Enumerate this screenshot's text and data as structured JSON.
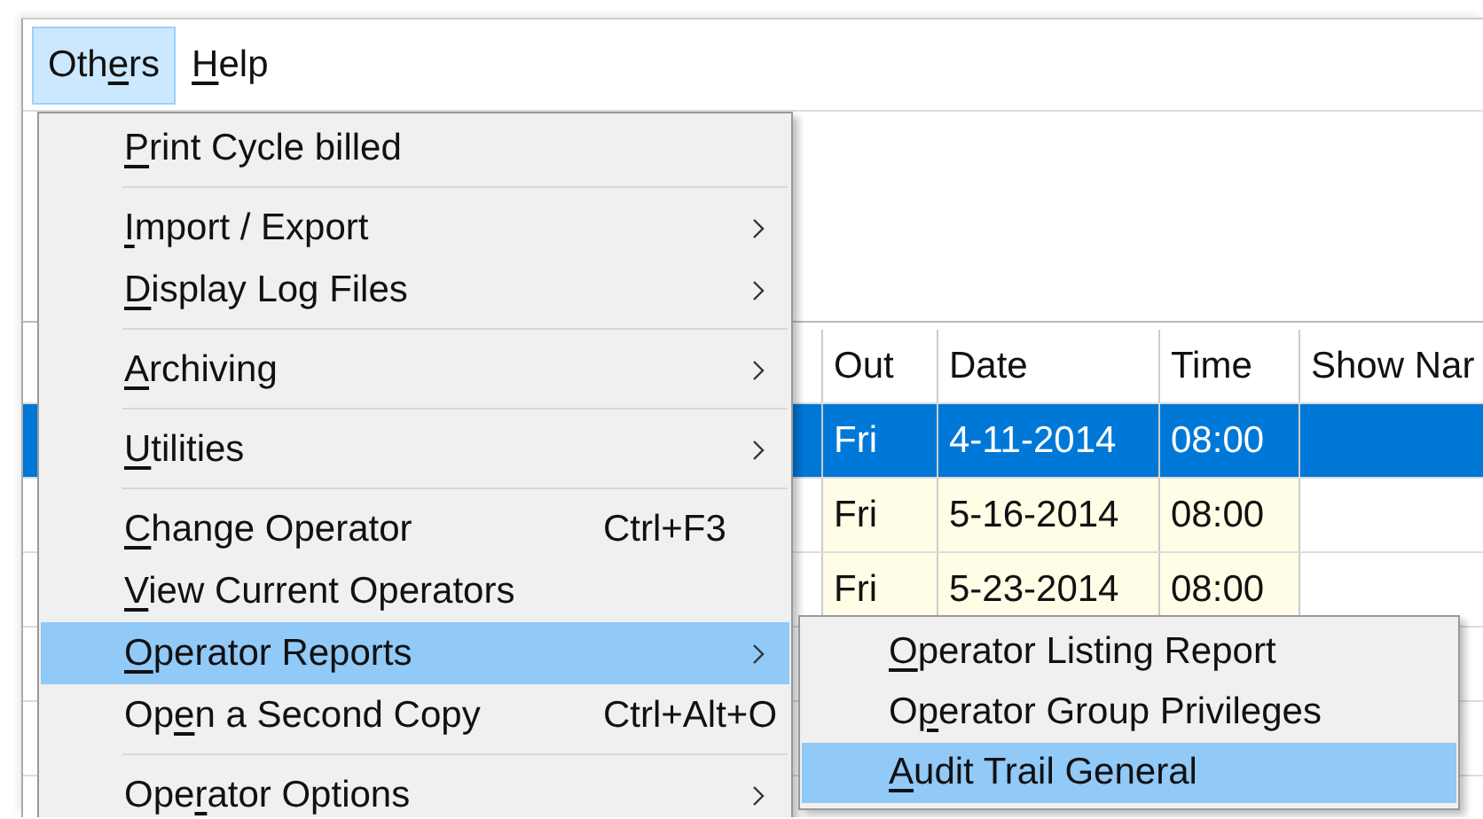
{
  "menu_bar": [
    {
      "label": {
        "before": "Oth",
        "key": "e",
        "after": "rs"
      },
      "selected": true
    },
    {
      "label": {
        "key": "H",
        "after": "elp"
      },
      "selected": false
    }
  ],
  "table": {
    "columns": [
      "Out",
      "Date",
      "Time",
      "Show Nar"
    ],
    "rows": [
      {
        "cells": [
          "Fri",
          "4-11-2014",
          "08:00",
          ""
        ],
        "selected": true
      },
      {
        "cells": [
          "Fri",
          "5-16-2014",
          "08:00",
          ""
        ],
        "selected": false
      },
      {
        "cells": [
          "Fri",
          "5-23-2014",
          "08:00",
          ""
        ],
        "selected": false
      }
    ]
  },
  "menu": {
    "items": [
      {
        "kind": "item",
        "label": {
          "key": "P",
          "after": "rint Cycle billed"
        },
        "selected": false,
        "submenu": false
      },
      {
        "kind": "separator"
      },
      {
        "kind": "item",
        "label": {
          "key": "I",
          "after": "mport / Export"
        },
        "selected": false,
        "submenu": true
      },
      {
        "kind": "item",
        "label": {
          "key": "D",
          "after": "isplay Log Files"
        },
        "selected": false,
        "submenu": true
      },
      {
        "kind": "separator"
      },
      {
        "kind": "item",
        "label": {
          "key": "A",
          "after": "rchiving"
        },
        "selected": false,
        "submenu": true
      },
      {
        "kind": "separator"
      },
      {
        "kind": "item",
        "label": {
          "key": "U",
          "after": "tilities"
        },
        "selected": false,
        "submenu": true
      },
      {
        "kind": "separator"
      },
      {
        "kind": "item",
        "label": {
          "key": "C",
          "after": "hange Operator"
        },
        "shortcut": "Ctrl+F3",
        "selected": false,
        "submenu": false
      },
      {
        "kind": "item",
        "label": {
          "key": "V",
          "after": "iew Current Operators"
        },
        "selected": false,
        "submenu": false
      },
      {
        "kind": "item",
        "label": {
          "key": "O",
          "after": "perator Reports"
        },
        "selected": true,
        "submenu": true
      },
      {
        "kind": "item",
        "label": {
          "before": "Op",
          "key": "e",
          "after": "n a Second Copy"
        },
        "shortcut": "Ctrl+Alt+O",
        "selected": false,
        "submenu": false
      },
      {
        "kind": "separator"
      },
      {
        "kind": "item",
        "label": {
          "before": "Ope",
          "key": "r",
          "after": "ator Options"
        },
        "selected": false,
        "submenu": true
      }
    ]
  },
  "submenu": {
    "items": [
      {
        "label": {
          "key": "O",
          "after": "perator Listing Report"
        },
        "selected": false
      },
      {
        "label": {
          "before": "O",
          "key": "p",
          "after": "erator Group Privileges"
        },
        "selected": false
      },
      {
        "label": {
          "key": "A",
          "after": "udit Trail General"
        },
        "selected": true
      }
    ]
  }
}
